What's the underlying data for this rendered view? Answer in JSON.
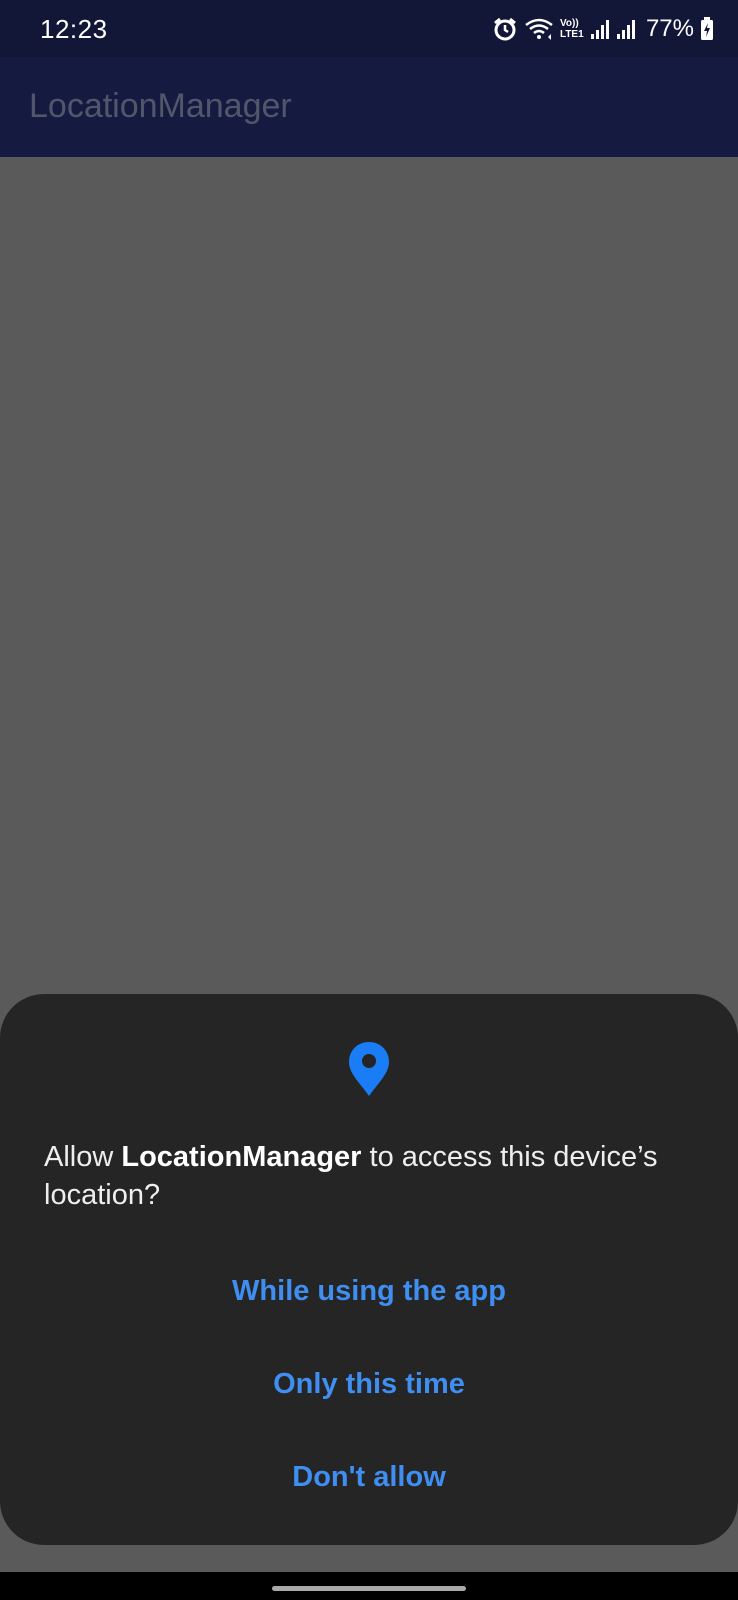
{
  "status_bar": {
    "time": "12:23",
    "network_label": "Vo)) LTE1",
    "battery": "77%",
    "icons": [
      "alarm-icon",
      "wifi-icon",
      "volte-icon",
      "signal-icon",
      "signal-icon",
      "battery-icon"
    ]
  },
  "app_bar": {
    "title": "LocationManager"
  },
  "dialog": {
    "icon": "location-pin-icon",
    "message_prefix": "Allow ",
    "app_name": "LocationManager",
    "message_suffix": " to access this device’s location?",
    "buttons": {
      "while_using": "While using the app",
      "only_this_time": "Only this time",
      "dont_allow": "Don't allow"
    }
  },
  "colors": {
    "status_bar_bg": "#121737",
    "app_bar_bg": "#151b40",
    "scrim": "#5a5a5a",
    "dialog_bg": "#252525",
    "accent": "#3f8ef1",
    "pin": "#1a7df5"
  }
}
